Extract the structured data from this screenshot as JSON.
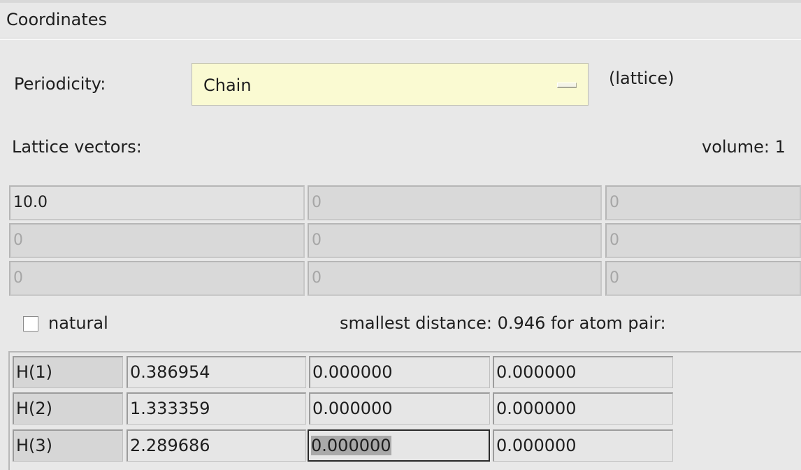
{
  "section": {
    "title": "Coordinates"
  },
  "periodicity": {
    "label": "Periodicity:",
    "value": "Chain",
    "note": "(lattice)"
  },
  "lattice": {
    "label": "Lattice vectors:",
    "volume_label": "volume: 1",
    "rows": [
      [
        "10.0",
        "0",
        "0"
      ],
      [
        "0",
        "0",
        "0"
      ],
      [
        "0",
        "0",
        "0"
      ]
    ]
  },
  "natural": {
    "label": "natural",
    "checked": false
  },
  "smallest_distance": {
    "text": "smallest distance:  0.946 for atom pair:"
  },
  "atoms": [
    {
      "name": "H(1)",
      "x": "0.386954",
      "y": "0.000000",
      "z": "0.000000"
    },
    {
      "name": "H(2)",
      "x": "1.333359",
      "y": "0.000000",
      "z": "0.000000"
    },
    {
      "name": "H(3)",
      "x": "2.289686",
      "y": "0.000000",
      "z": "0.000000"
    }
  ],
  "colors": {
    "dropdown_bg": "#fafad2",
    "panel_bg": "#e8e8e8"
  }
}
